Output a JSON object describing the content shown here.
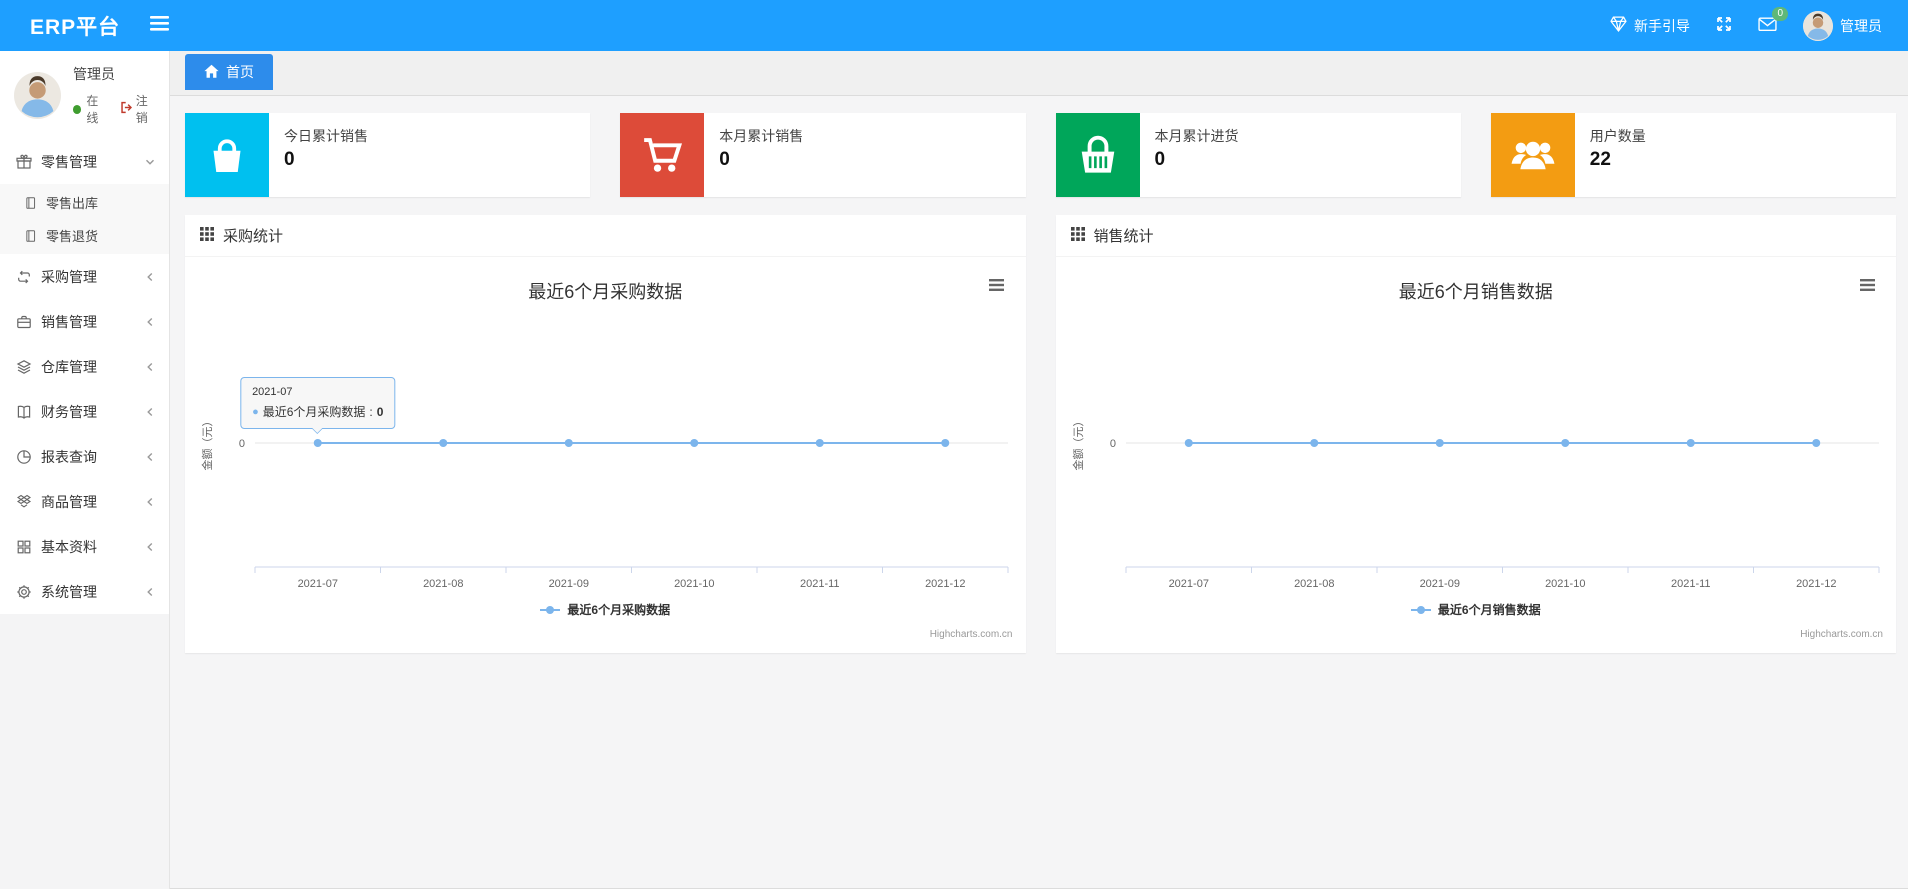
{
  "header": {
    "brand": "ERP平台",
    "guide_label": "新手引导",
    "mail_badge": "0",
    "username": "管理员"
  },
  "sidebar": {
    "user": {
      "name": "管理员",
      "status": "在线",
      "logout": "注销"
    },
    "menu": [
      {
        "label": "零售管理",
        "icon": "gift-icon",
        "state": "expanded",
        "children": [
          {
            "label": "零售出库",
            "icon": "journal-icon"
          },
          {
            "label": "零售退货",
            "icon": "journal-icon"
          }
        ]
      },
      {
        "label": "采购管理",
        "icon": "repeat-icon",
        "state": "collapsed"
      },
      {
        "label": "销售管理",
        "icon": "briefcase-icon",
        "state": "collapsed"
      },
      {
        "label": "仓库管理",
        "icon": "layers-icon",
        "state": "collapsed"
      },
      {
        "label": "财务管理",
        "icon": "book-open-icon",
        "state": "collapsed"
      },
      {
        "label": "报表查询",
        "icon": "pie-chart-icon",
        "state": "collapsed"
      },
      {
        "label": "商品管理",
        "icon": "package-icon",
        "state": "collapsed"
      },
      {
        "label": "基本资料",
        "icon": "grid-icon",
        "state": "collapsed"
      },
      {
        "label": "系统管理",
        "icon": "gear-icon",
        "state": "collapsed"
      }
    ]
  },
  "tabs": {
    "home_label": "首页"
  },
  "stat_cards": [
    {
      "label": "今日累计销售",
      "value": "0",
      "color": "#00c0ef",
      "icon": "shopping-bag-icon"
    },
    {
      "label": "本月累计销售",
      "value": "0",
      "color": "#dd4b39",
      "icon": "shopping-cart-icon"
    },
    {
      "label": "本月累计进货",
      "value": "0",
      "color": "#00a65a",
      "icon": "basket-icon"
    },
    {
      "label": "用户数量",
      "value": "22",
      "color": "#f39c12",
      "icon": "users-icon"
    }
  ],
  "panels": [
    {
      "title": "采购统计"
    },
    {
      "title": "销售统计"
    }
  ],
  "chart_data": [
    {
      "type": "line",
      "title": "最近6个月采购数据",
      "categories": [
        "2021-07",
        "2021-08",
        "2021-09",
        "2021-10",
        "2021-11",
        "2021-12"
      ],
      "series": [
        {
          "name": "最近6个月采购数据",
          "values": [
            0,
            0,
            0,
            0,
            0,
            0
          ],
          "color": "#7cb5ec"
        }
      ],
      "ylabel": "金额（元）",
      "yticks": [
        "0"
      ],
      "ylim": [
        0,
        0
      ],
      "grid": true,
      "legend_position": "bottom",
      "credits": "Highcharts.com.cn",
      "tooltip": {
        "visible": true,
        "point_index": 0,
        "header": "2021-07",
        "series_name": "最近6个月采购数据",
        "value": "0"
      }
    },
    {
      "type": "line",
      "title": "最近6个月销售数据",
      "categories": [
        "2021-07",
        "2021-08",
        "2021-09",
        "2021-10",
        "2021-11",
        "2021-12"
      ],
      "series": [
        {
          "name": "最近6个月销售数据",
          "values": [
            0,
            0,
            0,
            0,
            0,
            0
          ],
          "color": "#7cb5ec"
        }
      ],
      "ylabel": "金额（元）",
      "yticks": [
        "0"
      ],
      "ylim": [
        0,
        0
      ],
      "grid": true,
      "legend_position": "bottom",
      "credits": "Highcharts.com.cn",
      "tooltip": {
        "visible": false
      }
    }
  ],
  "colors": {
    "header_blue": "#1E9FFF",
    "tab_blue": "#2d8ceb",
    "series_blue": "#7cb5ec",
    "badge_green": "#5FB878",
    "online_green": "#3f9d2f"
  }
}
